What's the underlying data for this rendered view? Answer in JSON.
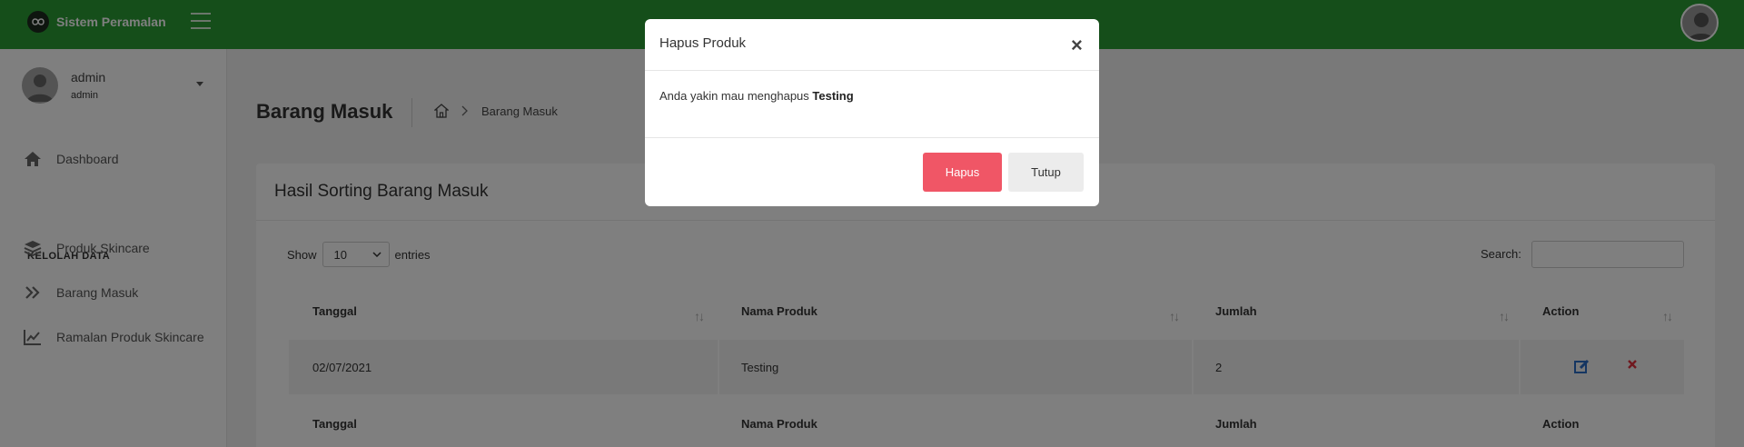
{
  "navbar": {
    "brand_name": "Sistem Peramalan",
    "color": "#2a9d34"
  },
  "sidebar": {
    "user": {
      "name": "admin",
      "role": "admin"
    },
    "section_title": "KELOLAH DATA",
    "items": [
      {
        "label": "Dashboard",
        "icon": "home-icon"
      },
      {
        "label": "Produk Skincare",
        "icon": "layers-icon"
      },
      {
        "label": "Barang Masuk",
        "icon": "double-chevron-right-icon"
      },
      {
        "label": "Ramalan Produk Skincare",
        "icon": "line-chart-icon"
      }
    ]
  },
  "page": {
    "title": "Barang Masuk",
    "breadcrumb_current": "Barang Masuk"
  },
  "card": {
    "title": "Hasil Sorting Barang Masuk",
    "show_label": "Show",
    "entries_value": "10",
    "entries_label": "entries",
    "search_label": "Search:",
    "search_value": ""
  },
  "table": {
    "columns": [
      "Tanggal",
      "Nama Produk",
      "Jumlah",
      "Action"
    ],
    "rows": [
      {
        "tanggal": "02/07/2021",
        "nama_produk": "Testing",
        "jumlah": "2"
      }
    ]
  },
  "modal": {
    "title": "Hapus Produk",
    "message_prefix": "Anda yakin mau menghapus",
    "message_item": "Testing",
    "confirm_label": "Hapus",
    "cancel_label": "Tutup",
    "confirm_color": "#f05666"
  }
}
